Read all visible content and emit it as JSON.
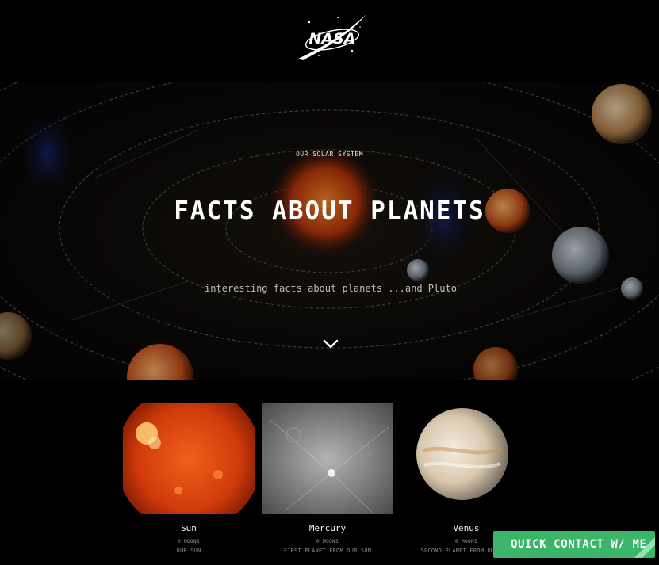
{
  "header": {
    "logo_text": "NASA"
  },
  "hero": {
    "kicker": "OUR SOLAR SYSTEM",
    "title": "FACTS ABOUT PLANETS",
    "subtitle": "interesting facts about planets ...and Pluto",
    "scroll_icon": "chevron-down-icon"
  },
  "planets": [
    {
      "name": "Sun",
      "moons": "0 MOONS",
      "desc": "OUR SUN"
    },
    {
      "name": "Mercury",
      "moons": "0 MOONS",
      "desc": "FIRST PLANET FROM OUR SUN"
    },
    {
      "name": "Venus",
      "moons": "0 MOONS",
      "desc": "SECOND PLANET FROM OUR SUN"
    }
  ],
  "contact": {
    "label": "QUICK CONTACT W/ ME",
    "color": "#3bb56a"
  },
  "colors": {
    "background": "#000000",
    "sun": "#d9420f",
    "mercury": "#8a8a8a",
    "venus": "#e9dcc6"
  }
}
